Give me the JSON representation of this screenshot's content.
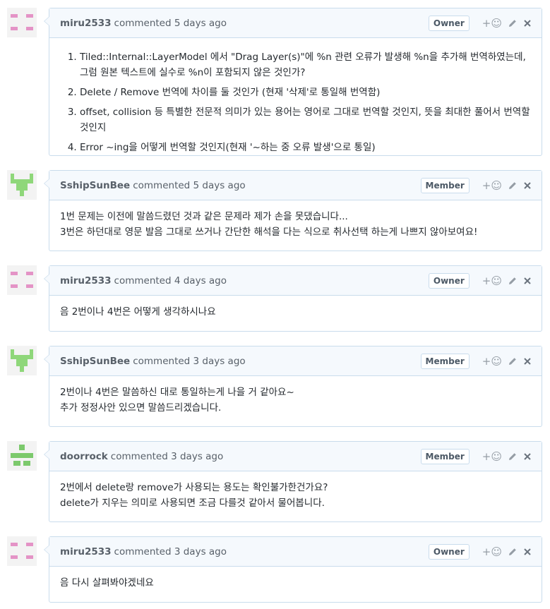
{
  "roles": {
    "owner": "Owner",
    "member": "Member"
  },
  "comments": [
    {
      "author": "miru2533",
      "time": "commented 5 days ago",
      "role": "Owner",
      "avatar": "pink",
      "items": [
        "Tiled::Internal::LayerModel 에서 \"Drag Layer(s)\"에 %n 관련 오류가 발생해 %n을 추가해 번역하였는데, 그럼 원본 텍스트에 실수로 %n이 포함되지 않은 것인가?",
        "Delete / Remove 번역에 차이를 둘 것인가 (현재 '삭제'로 통일해 번역함)",
        "offset, collision 등 특별한 전문적 의미가 있는 용어는 영어로 그대로 번역할 것인지, 뜻을 최대한 풀어서 번역할 것인지",
        "Error ~ing을 어떻게 번역할 것인지(현재 '~하는 중 오류 발생'으로 통일)"
      ]
    },
    {
      "author": "SshipSunBee",
      "time": "commented 5 days ago",
      "role": "Member",
      "avatar": "green",
      "lines": [
        "1번 문제는 이전에 말씀드렸던 것과 같은 문제라 제가 손을 못댔습니다...",
        "3번은 하던대로 영문 발음 그대로 쓰거나 간단한 해석을 다는 식으로 취사선택 하는게 나쁘지 않아보여요!"
      ]
    },
    {
      "author": "miru2533",
      "time": "commented 4 days ago",
      "role": "Owner",
      "avatar": "pink",
      "lines": [
        "음 2번이나 4번은 어떻게 생각하시나요"
      ]
    },
    {
      "author": "SshipSunBee",
      "time": "commented 3 days ago",
      "role": "Member",
      "avatar": "green",
      "lines": [
        "2번이나 4번은 말씀하신 대로 통일하는게 나을 거 같아요~",
        "추가 정정사안 있으면 말씀드리겠습니다."
      ]
    },
    {
      "author": "doorrock",
      "time": "commented 3 days ago",
      "role": "Member",
      "avatar": "green2",
      "lines": [
        "2번에서 delete랑 remove가 사용되는 용도는 확인불가한건가요?",
        "delete가 지우는 의미로 사용되면 조금 다를것 같아서 물어봅니다."
      ]
    },
    {
      "author": "miru2533",
      "time": "commented 3 days ago",
      "role": "Owner",
      "avatar": "pink",
      "lines": [
        "음 다시 살펴봐야겠네요"
      ]
    }
  ],
  "icons": {
    "react": "smiley-icon",
    "edit": "pencil-icon",
    "delete": "close-icon"
  },
  "colors": {
    "pink": "#e493c6",
    "green": "#8fd77a",
    "green2": "#7cc96c",
    "border": "#c9dcec",
    "header_bg": "#f5f9fd"
  }
}
